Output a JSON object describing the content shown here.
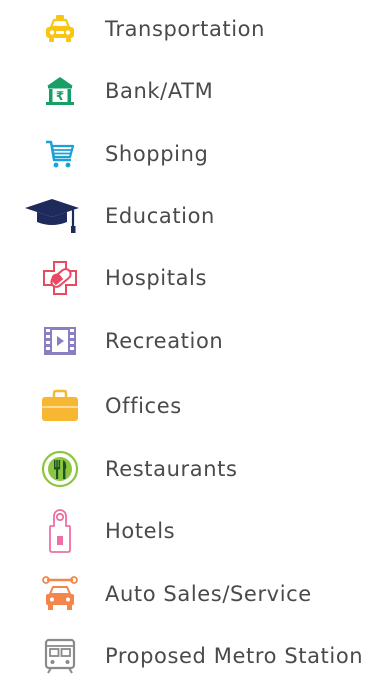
{
  "legend": {
    "items": [
      {
        "label": "Transportation",
        "icon": "taxi-icon",
        "color": "#F9C513"
      },
      {
        "label": "Bank/ATM",
        "icon": "bank-icon",
        "color": "#16A068"
      },
      {
        "label": "Shopping",
        "icon": "shopping-cart-icon",
        "color": "#1AA1D5"
      },
      {
        "label": "Education",
        "icon": "graduation-cap-icon",
        "color": "#1F2A5C"
      },
      {
        "label": "Hospitals",
        "icon": "hospital-icon",
        "color": "#E84A63"
      },
      {
        "label": "Recreation",
        "icon": "film-strip-icon",
        "color": "#8B7EC3"
      },
      {
        "label": "Offices",
        "icon": "briefcase-icon",
        "color": "#F7B733"
      },
      {
        "label": "Restaurants",
        "icon": "cutlery-icon",
        "color": "#8CC63F"
      },
      {
        "label": "Hotels",
        "icon": "door-hanger-icon",
        "color": "#EE6FA5"
      },
      {
        "label": "Auto Sales/Service",
        "icon": "car-service-icon",
        "color": "#F4864C"
      },
      {
        "label": "Proposed Metro Station",
        "icon": "metro-train-icon",
        "color": "#8A8A8A"
      }
    ]
  }
}
